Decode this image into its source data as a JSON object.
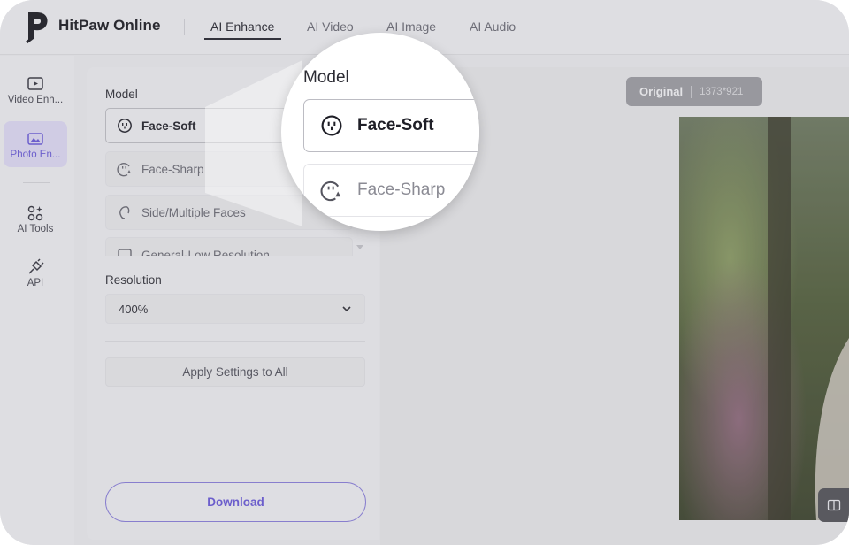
{
  "app": {
    "brand": "HitPaw Online"
  },
  "nav": {
    "tabs": [
      {
        "label": "AI Enhance",
        "active": true
      },
      {
        "label": "AI Video",
        "active": false
      },
      {
        "label": "AI Image",
        "active": false
      },
      {
        "label": "AI Audio",
        "active": false
      }
    ]
  },
  "rail": {
    "items": [
      {
        "label": "Video Enh...",
        "icon": "hd-video-icon",
        "active": false
      },
      {
        "label": "Photo En...",
        "icon": "photo-enhance-icon",
        "active": true
      },
      {
        "label": "AI Tools",
        "icon": "ai-tools-icon",
        "active": false
      },
      {
        "label": "API",
        "icon": "api-plug-icon",
        "active": false
      }
    ]
  },
  "panel": {
    "model_label": "Model",
    "models": [
      {
        "label": "Face-Soft",
        "icon": "face-soft-icon",
        "selected": true
      },
      {
        "label": "Face-Sharp",
        "icon": "face-sharp-icon",
        "selected": false
      },
      {
        "label": "Side/Multiple Faces",
        "icon": "side-faces-icon",
        "selected": false
      },
      {
        "label": "General-Low Resolution",
        "icon": "general-icon",
        "selected": false
      }
    ],
    "resolution_label": "Resolution",
    "resolution_value": "400%",
    "apply_label": "Apply Settings to All",
    "download_label": "Download"
  },
  "preview": {
    "badge_label": "Original",
    "badge_dims": "1373*921"
  },
  "magnifier": {
    "label": "Model",
    "selected": "Face-Soft",
    "other": "Face-Sharp"
  },
  "colors": {
    "accent": "#6a5bd6",
    "active_bg": "#dcd8f2"
  }
}
